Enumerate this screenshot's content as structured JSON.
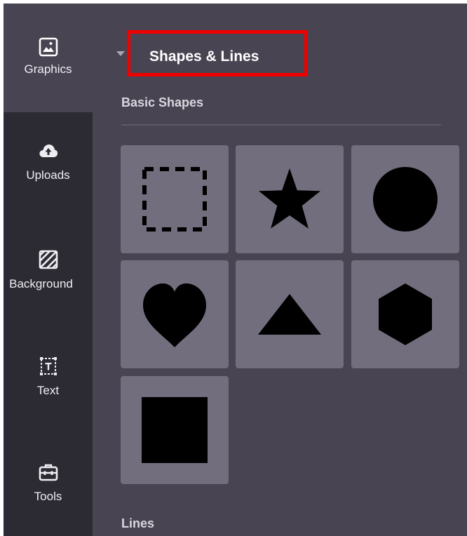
{
  "sidebar": {
    "items": [
      {
        "label": "Graphics",
        "icon": "image-icon",
        "active": true
      },
      {
        "label": "Uploads",
        "icon": "cloud-upload-icon"
      },
      {
        "label": "Background",
        "icon": "background-pattern-icon"
      },
      {
        "label": "Text",
        "icon": "text-box-icon"
      },
      {
        "label": "Tools",
        "icon": "toolbox-icon"
      }
    ]
  },
  "panel": {
    "title": "Shapes & Lines",
    "sections": [
      {
        "label": "Basic Shapes",
        "shapes": [
          "dashed-square",
          "star",
          "circle",
          "heart",
          "triangle",
          "hexagon",
          "square"
        ]
      },
      {
        "label": "Lines"
      }
    ]
  },
  "colors": {
    "sidebar_bg": "#2c2a33",
    "panel_bg": "#484452",
    "tile_bg": "#726e7e",
    "highlight": "#f10000"
  }
}
